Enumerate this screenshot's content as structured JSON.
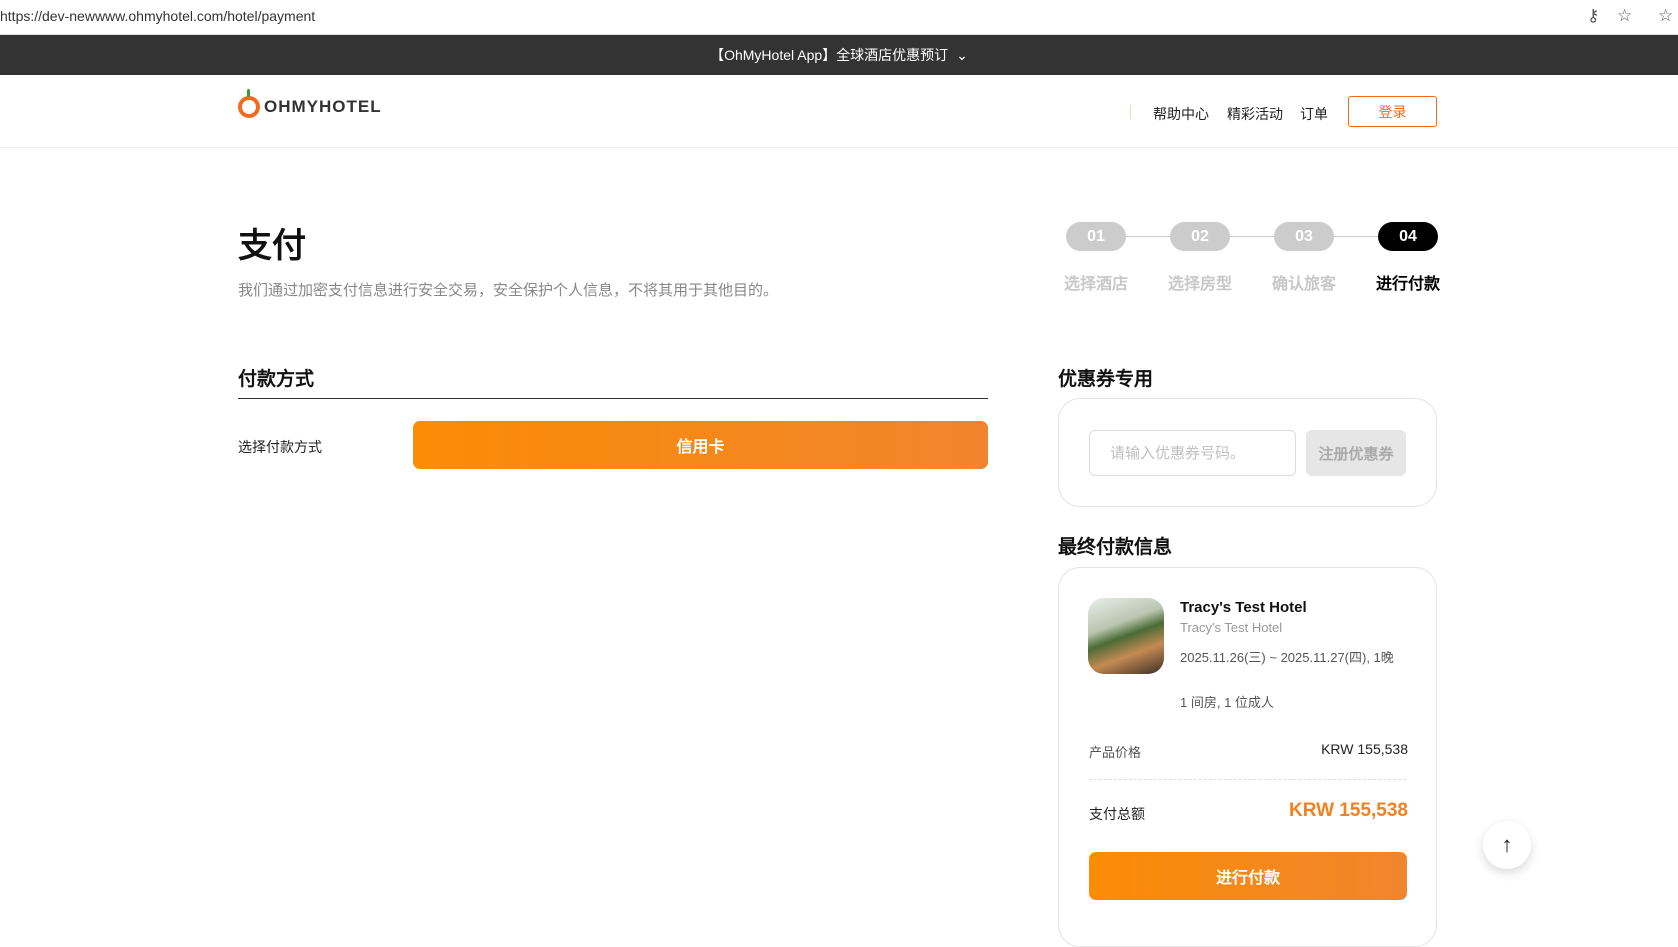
{
  "browser": {
    "url": "https://dev-newwww.ohmyhotel.com/hotel/payment"
  },
  "banner": {
    "text": "【OhMyHotel App】全球酒店优惠预订",
    "chevron": "⌄"
  },
  "header": {
    "logo": "OHMYHOTEL",
    "nav": [
      "帮助中心",
      "精彩活动",
      "订单"
    ],
    "login": "登录"
  },
  "page": {
    "title": "支付",
    "subtitle": "我们通过加密支付信息进行安全交易，安全保护个人信息，不将其用于其他目的。"
  },
  "steps": [
    {
      "num": "01",
      "label": "选择酒店"
    },
    {
      "num": "02",
      "label": "选择房型"
    },
    {
      "num": "03",
      "label": "确认旅客"
    },
    {
      "num": "04",
      "label": "进行付款"
    }
  ],
  "payment_method": {
    "heading": "付款方式",
    "label": "选择付款方式",
    "option": "信用卡"
  },
  "coupon": {
    "heading": "优惠券专用",
    "placeholder": "请输入优惠券号码。",
    "button": "注册优惠券"
  },
  "summary": {
    "heading": "最终付款信息",
    "hotel_name": "Tracy's Test Hotel",
    "hotel_subname": "Tracy's Test Hotel",
    "dates": "2025.11.26(三) ~ 2025.11.27(四), 1晚",
    "occupancy": "1 间房, 1 位成人",
    "price_label": "产品价格",
    "price_value": "KRW 155,538",
    "total_label": "支付总额",
    "total_value": "KRW 155,538",
    "pay_button": "进行付款"
  },
  "colors": {
    "accent": "#f26b1d",
    "total": "#f5801f"
  }
}
